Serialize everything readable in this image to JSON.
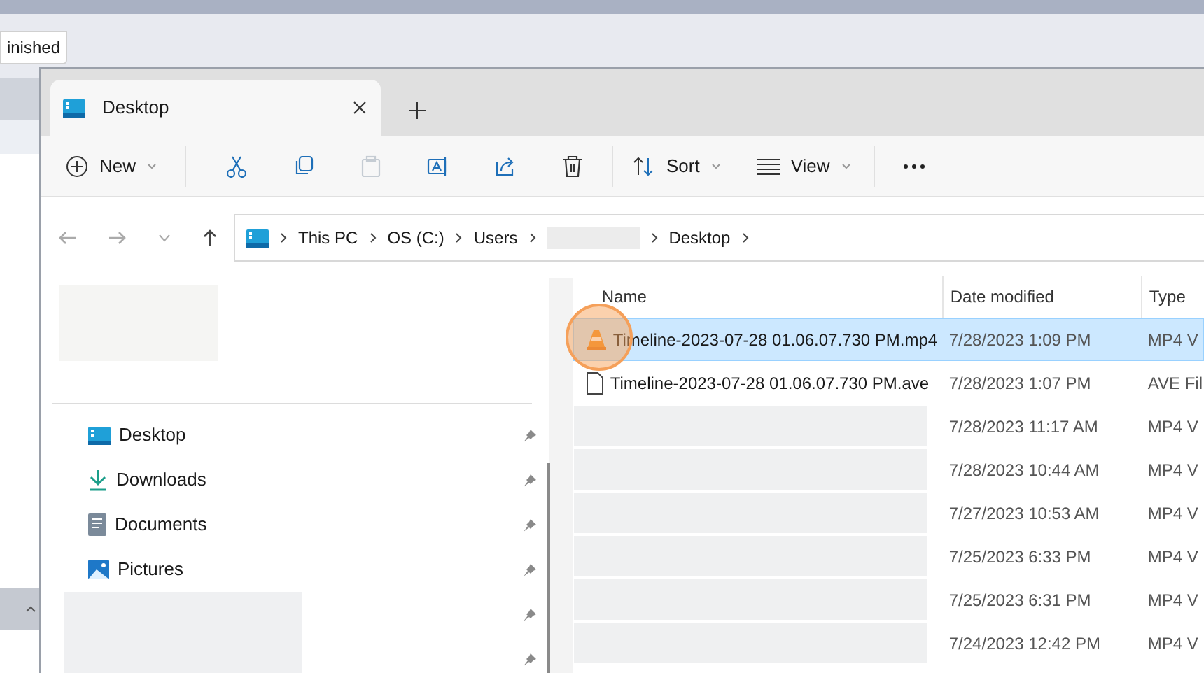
{
  "background_window": {
    "label": "inished"
  },
  "tabs": [
    {
      "title": "Desktop",
      "selected": true
    }
  ],
  "toolbar": {
    "new_label": "New",
    "sort_label": "Sort",
    "view_label": "View",
    "buttons": [
      {
        "kind": "cut",
        "disabled": false
      },
      {
        "kind": "copy",
        "disabled": false
      },
      {
        "kind": "paste",
        "disabled": true
      },
      {
        "kind": "rename",
        "disabled": false
      },
      {
        "kind": "share",
        "disabled": false
      },
      {
        "kind": "delete",
        "disabled": false
      }
    ]
  },
  "address_bar": {
    "crumbs": [
      {
        "label": "This PC",
        "kind": "text"
      },
      {
        "label": "OS (C:)",
        "kind": "text"
      },
      {
        "label": "Users",
        "kind": "text"
      },
      {
        "kind": "redacted"
      },
      {
        "label": "Desktop",
        "kind": "text"
      }
    ]
  },
  "sidebar": {
    "items": [
      {
        "label": "Desktop",
        "kind": "desktop"
      },
      {
        "label": "Downloads",
        "kind": "downloads"
      },
      {
        "label": "Documents",
        "kind": "documents"
      },
      {
        "label": "Pictures",
        "kind": "pictures"
      },
      {
        "kind": "redacted"
      },
      {
        "kind": "redacted"
      }
    ]
  },
  "table": {
    "columns": [
      "Name",
      "Date modified",
      "Type"
    ],
    "rows": [
      {
        "name": "Timeline-2023-07-28 01.06.07.730 PM.mp4",
        "kind": "video",
        "date": "7/28/2023 1:09 PM",
        "type": "MP4 V",
        "selected": true
      },
      {
        "name": "Timeline-2023-07-28 01.06.07.730 PM.ave",
        "kind": "file",
        "date": "7/28/2023 1:07 PM",
        "type": "AVE Fil",
        "selected": false
      },
      {
        "kind": "redacted",
        "date": "7/28/2023 11:17 AM",
        "type": "MP4 V",
        "selected": false
      },
      {
        "kind": "redacted",
        "date": "7/28/2023 10:44 AM",
        "type": "MP4 V",
        "selected": false
      },
      {
        "kind": "redacted",
        "date": "7/27/2023 10:53 AM",
        "type": "MP4 V",
        "selected": false
      },
      {
        "kind": "redacted",
        "date": "7/25/2023 6:33 PM",
        "type": "MP4 V",
        "selected": false
      },
      {
        "kind": "redacted",
        "date": "7/25/2023 6:31 PM",
        "type": "MP4 V",
        "selected": false
      },
      {
        "kind": "redacted",
        "date": "7/24/2023 12:42 PM",
        "type": "MP4 V",
        "selected": false
      }
    ]
  }
}
